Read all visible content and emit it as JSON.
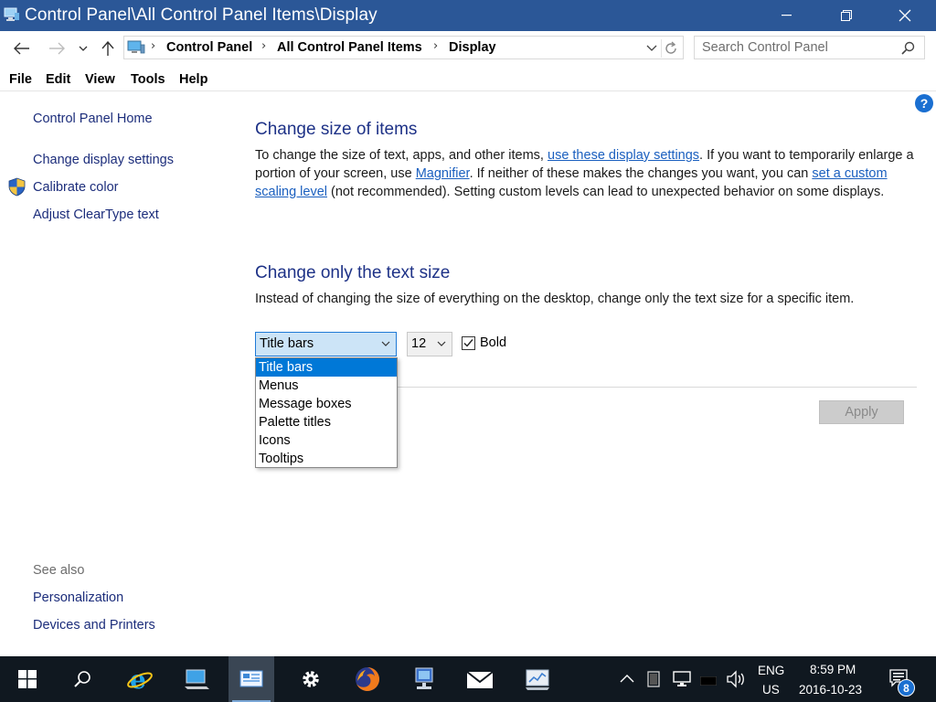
{
  "window": {
    "title": "Control Panel\\All Control Panel Items\\Display"
  },
  "address": {
    "crumbs": [
      "Control Panel",
      "All Control Panel Items",
      "Display"
    ],
    "search_placeholder": "Search Control Panel"
  },
  "menubar": {
    "items": [
      "File",
      "Edit",
      "View",
      "Tools",
      "Help"
    ]
  },
  "sidebar": {
    "home": "Control Panel Home",
    "links": [
      "Change display settings",
      "Calibrate color",
      "Adjust ClearType text"
    ],
    "see_also_label": "See also",
    "see_also": [
      "Personalization",
      "Devices and Printers"
    ]
  },
  "main": {
    "section1": {
      "heading": "Change size of items",
      "text_1": "To change the size of text, apps, and other items, ",
      "link_1": "use these display settings",
      "text_2": ".  If you want to temporarily enlarge a portion of your screen, use ",
      "link_2": "Magnifier",
      "text_3": ".  If neither of these makes the changes you want, you can ",
      "link_3": "set a custom scaling level",
      "text_4": " (not recommended).  Setting custom levels can lead to unexpected behavior on some displays."
    },
    "section2": {
      "heading": "Change only the text size",
      "description": "Instead of changing the size of everything on the desktop, change only the text size for a specific item."
    },
    "item_select": {
      "value": "Title bars",
      "options": [
        "Title bars",
        "Menus",
        "Message boxes",
        "Palette titles",
        "Icons",
        "Tooltips"
      ]
    },
    "size_select": {
      "value": "12"
    },
    "bold_checkbox": {
      "label": "Bold",
      "checked": true
    },
    "apply_label": "Apply"
  },
  "taskbar": {
    "language": "ENG",
    "region": "US",
    "time": "8:59 PM",
    "date": "2016-10-23",
    "notification_count": "8"
  },
  "colors": {
    "titlebar": "#2b5797",
    "link": "#1a5fbf",
    "heading": "#1e3287",
    "selection": "#0078d7",
    "taskbar": "#101820"
  }
}
